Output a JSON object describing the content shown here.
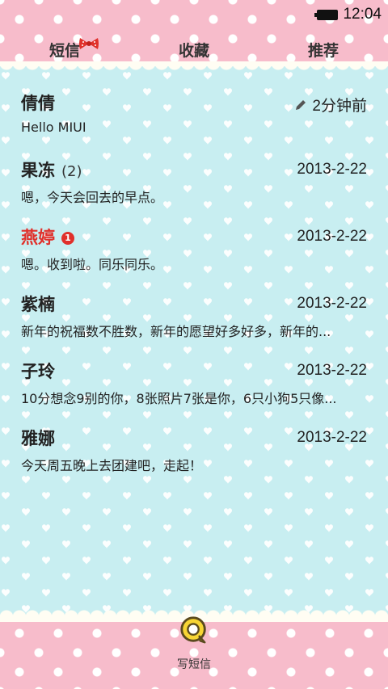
{
  "status_bar": {
    "time": "12:04"
  },
  "tabs": [
    {
      "label": "短信",
      "active": true
    },
    {
      "label": "收藏",
      "active": false
    },
    {
      "label": "推荐",
      "active": false
    }
  ],
  "conversations": [
    {
      "name": "倩倩",
      "count": "",
      "unread": false,
      "date": "2分钟前",
      "draft": true,
      "snippet": "Hello MIUI"
    },
    {
      "name": "果冻",
      "count": "(2)",
      "unread": false,
      "date": "2013-2-22",
      "draft": false,
      "snippet": "嗯，今天会回去的早点。"
    },
    {
      "name": "燕婷",
      "count": "",
      "unread": true,
      "badge": "1",
      "date": "2013-2-22",
      "draft": false,
      "snippet": "嗯。收到啦。同乐同乐。"
    },
    {
      "name": "紫楠",
      "count": "",
      "unread": false,
      "date": "2013-2-22",
      "draft": false,
      "snippet": "新年的祝福数不胜数，新年的愿望好多好多，新年的..."
    },
    {
      "name": "子玲",
      "count": "",
      "unread": false,
      "date": "2013-2-22",
      "draft": false,
      "snippet": "10分想念9别的你，8张照片7张是你，6只小狗5只像..."
    },
    {
      "name": "雅娜",
      "count": "",
      "unread": false,
      "date": "2013-2-22",
      "draft": false,
      "snippet": "今天周五晚上去团建吧，走起！"
    }
  ],
  "compose": {
    "label": "写短信",
    "icon": "compose-bubble-icon"
  },
  "colors": {
    "pink_bg": "#f7bccb",
    "main_bg": "#c8eef1",
    "unread_name": "#e0302b",
    "compose_yellow": "#f7d534"
  }
}
